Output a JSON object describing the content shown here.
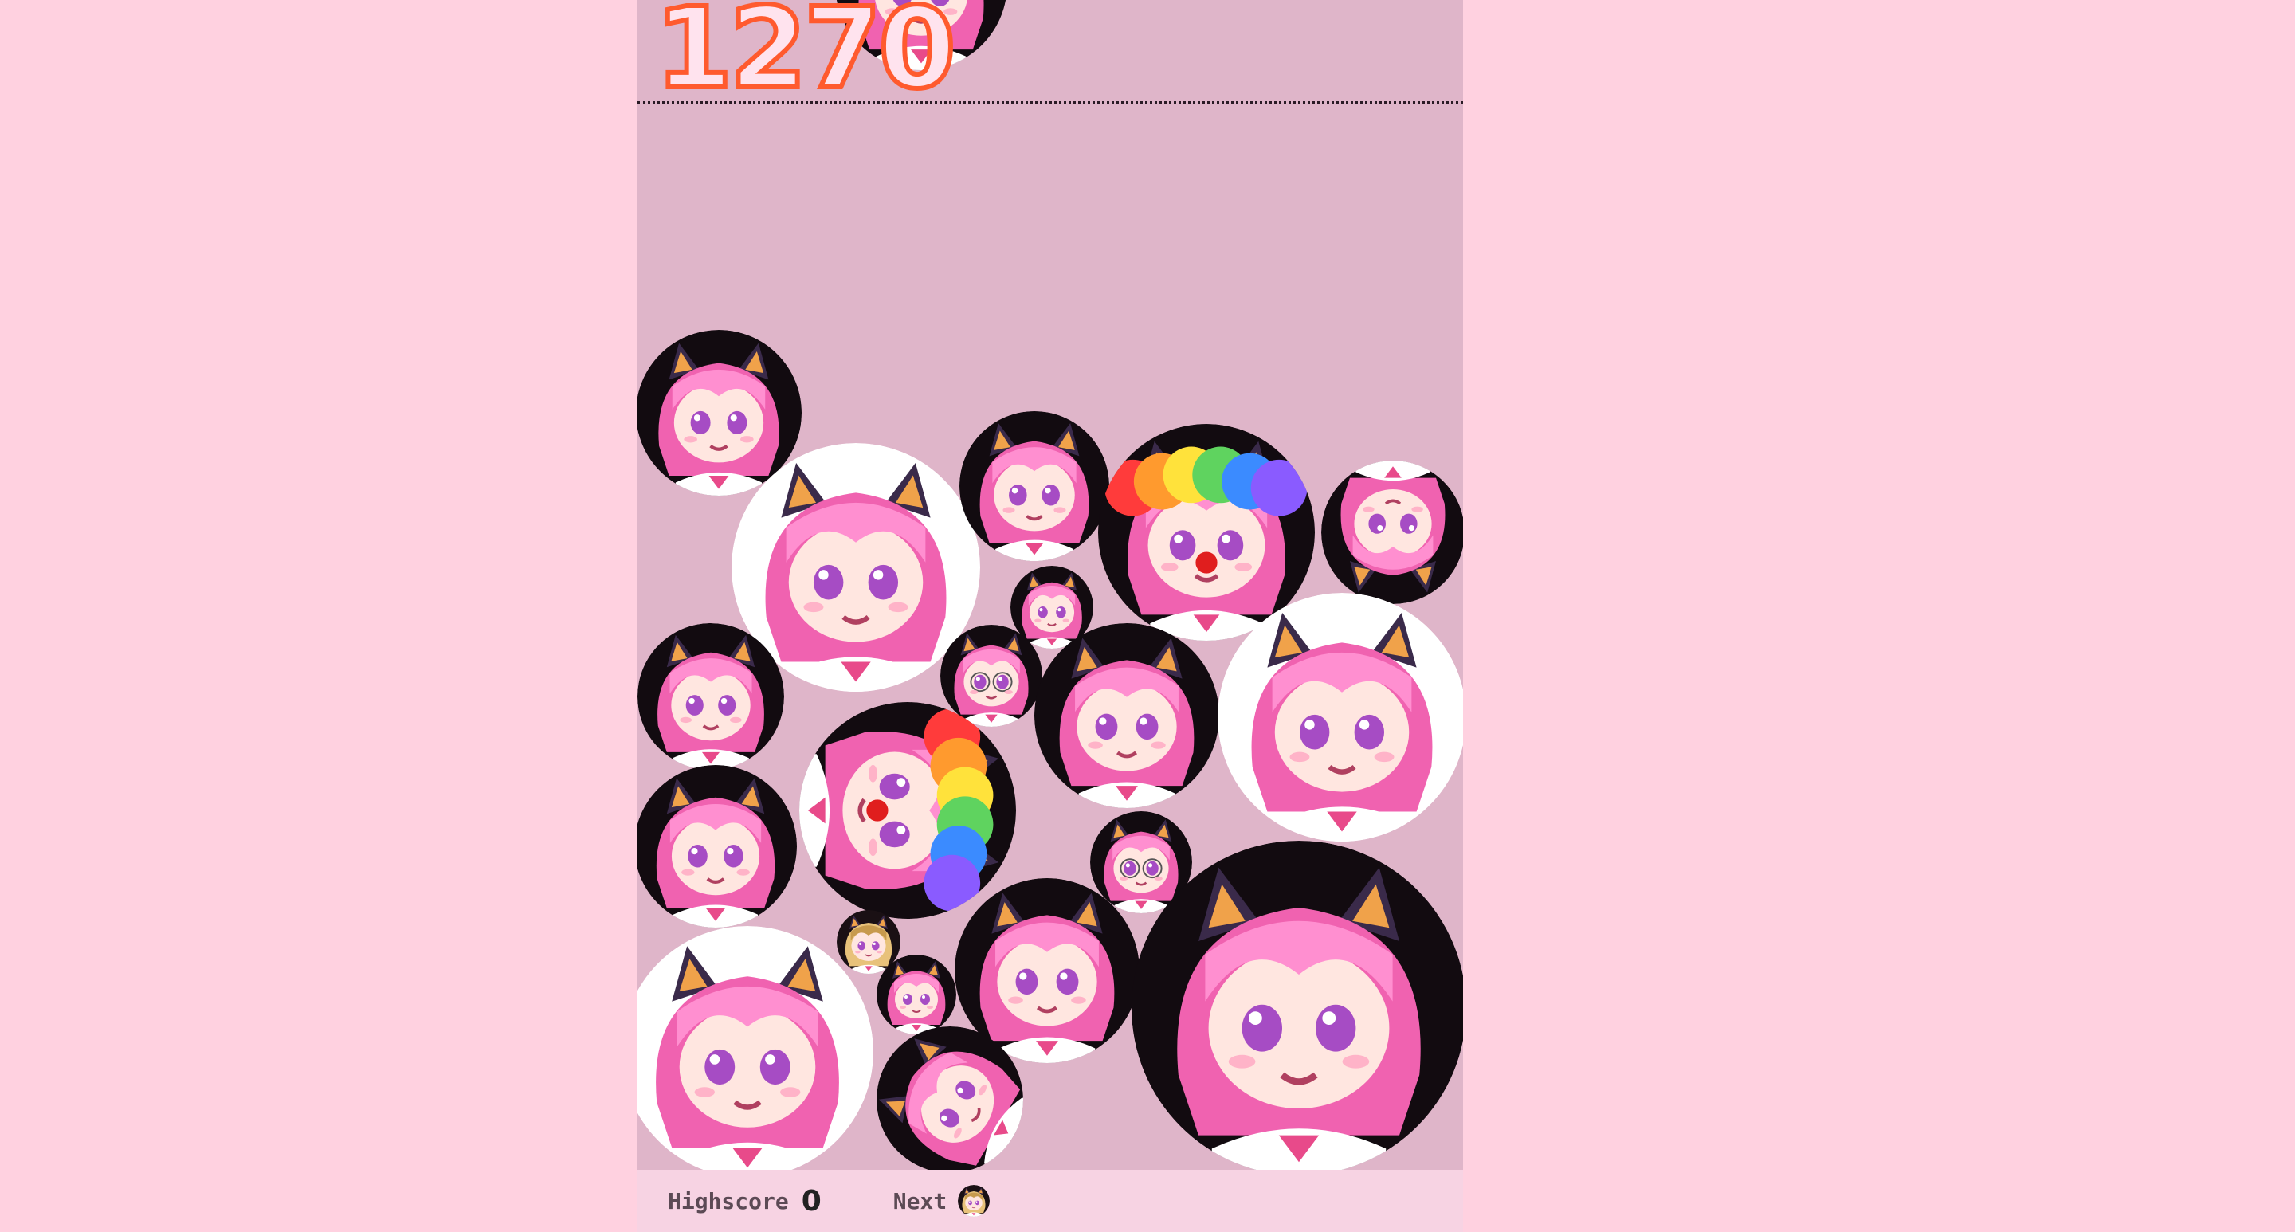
{
  "game": {
    "score": "1270",
    "highscore_label": "Highscore",
    "highscore_value": "0",
    "next_label": "Next",
    "next_ball_icon": "chibi-blonde-icon"
  },
  "colors": {
    "page_background": "#ffd1e0",
    "board_background": "#dfb5c9",
    "footer_background": "#f7d3e3",
    "score_fill": "#ffe3ee",
    "score_stroke": "#ff5a2e",
    "hair_pink": "#f062b0",
    "eye_purple": "#a64cc4"
  },
  "balls": [
    {
      "icon": "chibi-tilted-icon"
    },
    {
      "icon": "chibi-open-mouth-icon"
    },
    {
      "icon": "chibi-shy-icon"
    },
    {
      "icon": "chibi-tongue-icon"
    },
    {
      "icon": "chibi-small-icon"
    },
    {
      "icon": "chibi-clown-icon"
    },
    {
      "icon": "chibi-upside-down-icon"
    },
    {
      "icon": "chibi-tongue-icon"
    },
    {
      "icon": "chibi-glasses-icon"
    },
    {
      "icon": "chibi-drink-icon"
    },
    {
      "icon": "chibi-shy-icon"
    },
    {
      "icon": "chibi-smile-icon"
    },
    {
      "icon": "chibi-clown-icon"
    },
    {
      "icon": "chibi-glasses-icon"
    },
    {
      "icon": "chibi-blonde-icon"
    },
    {
      "icon": "chibi-small-icon"
    },
    {
      "icon": "chibi-drink-icon"
    },
    {
      "icon": "chibi-shy-icon"
    },
    {
      "icon": "chibi-tongue-icon"
    },
    {
      "icon": "chibi-open-mouth-icon"
    }
  ]
}
